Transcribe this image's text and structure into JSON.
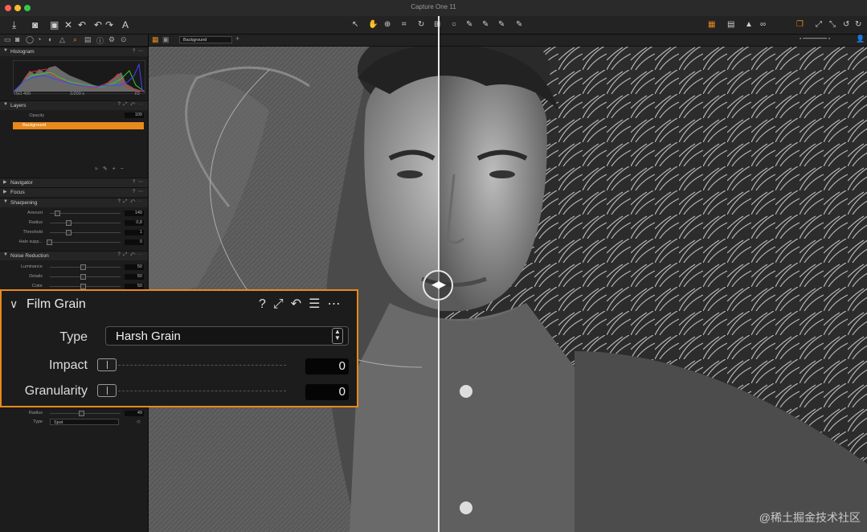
{
  "window": {
    "title": "Capture One 11"
  },
  "toolbar": {
    "left_icons": [
      "import-icon",
      "camera-icon",
      "export-icon",
      "delete-icon",
      "undo-icon",
      "redo-icon",
      "auto-adjust-icon"
    ],
    "center_icons": [
      "select-cursor-icon",
      "pan-hand-icon",
      "zoom-icon",
      "crop-icon",
      "rotate-icon",
      "keystone-icon",
      "spot-icon",
      "brush-icon",
      "eraser-icon",
      "picker-icon",
      "gradient-icon"
    ],
    "right_icons": [
      "grid-icon",
      "exposure-warning-icon",
      "proof-glasses-icon",
      "copy-apply-icon",
      "expand-icon",
      "reset-icon",
      "undo-arrow-icon"
    ]
  },
  "left_panel": {
    "histogram": {
      "title": "Histogram",
      "iso": "ISO 400",
      "shutter": "1/200 s",
      "aperture": "f/2"
    },
    "layers": {
      "title": "Layers",
      "opacity_label": "Opacity",
      "opacity_value": "100",
      "selected_layer": "Background"
    },
    "sections": {
      "navigator": "Navigator",
      "focus": "Focus",
      "sharpening": "Sharpening",
      "noise_reduction": "Noise Reduction"
    },
    "sharpening_rows": [
      {
        "label": "Amount",
        "value": "140"
      },
      {
        "label": "Radius",
        "value": "0,8"
      },
      {
        "label": "Threshold",
        "value": "1"
      },
      {
        "label": "Halo supp...",
        "value": "0"
      }
    ],
    "noise_rows": [
      {
        "label": "Luminance",
        "value": "50"
      },
      {
        "label": "Details",
        "value": "50"
      },
      {
        "label": "Color",
        "value": "50"
      }
    ],
    "vignette_rows": [
      {
        "label": "Radius",
        "value": "49"
      },
      {
        "label": "Type",
        "value": "Spot"
      }
    ]
  },
  "viewer": {
    "layer_select": "Background"
  },
  "film_grain": {
    "title": "Film Grain",
    "type_label": "Type",
    "type_value": "Harsh Grain",
    "impact_label": "Impact",
    "impact_value": "0",
    "granularity_label": "Granularity",
    "granularity_value": "0",
    "help": "?",
    "more": "⋯"
  },
  "footer": {
    "watermark": "@稀土掘金技术社区"
  },
  "colors": {
    "accent": "#e8891c",
    "panel": "#1c1c1c"
  }
}
